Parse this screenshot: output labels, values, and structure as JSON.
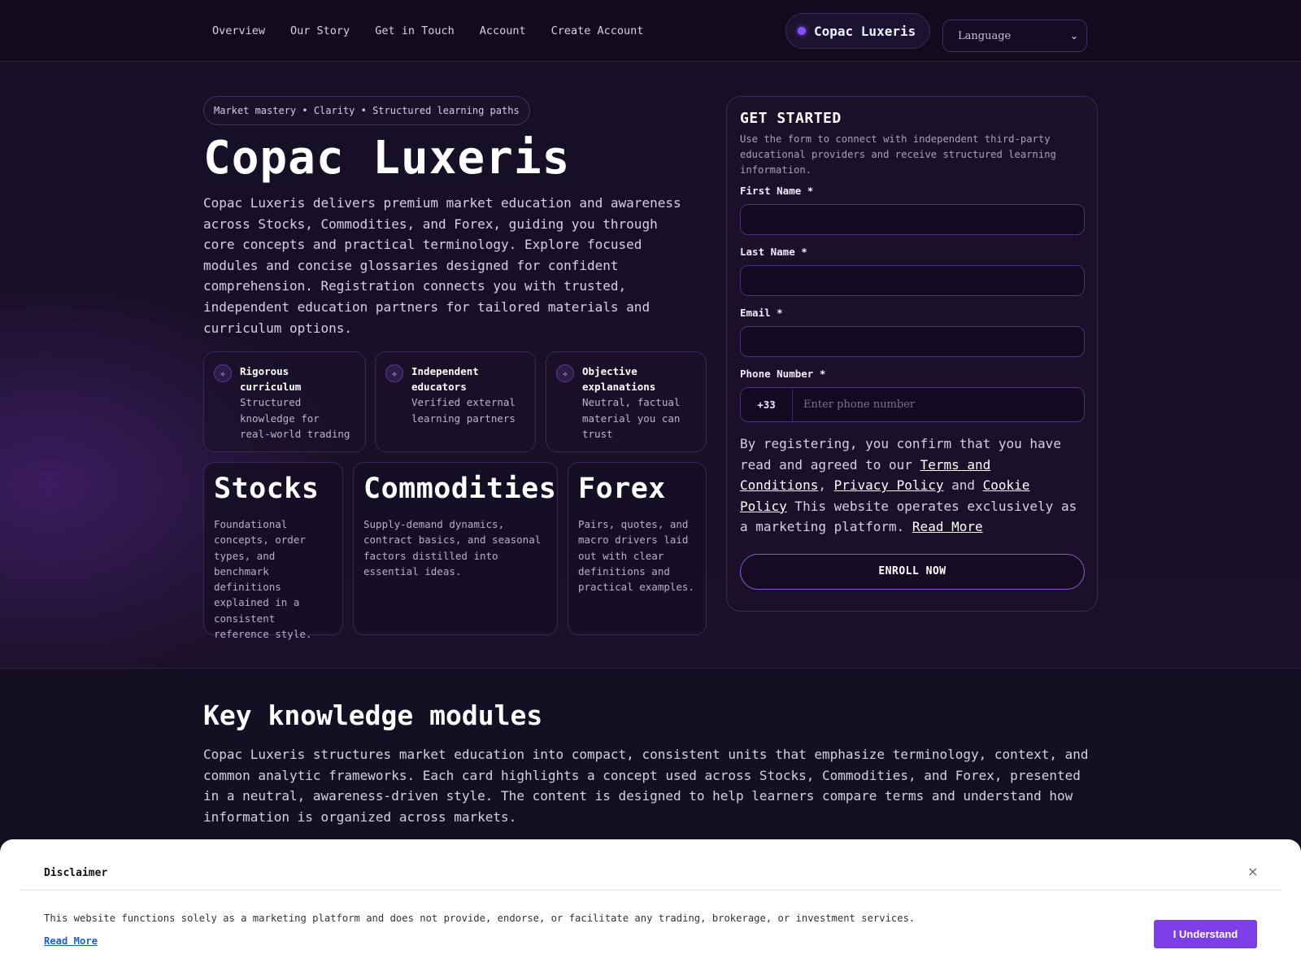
{
  "nav": {
    "items": [
      "Overview",
      "Our Story",
      "Get in Touch",
      "Account",
      "Create Account"
    ],
    "brand": "Copac Luxeris",
    "language_label": "Language"
  },
  "hero": {
    "tagline": "Market mastery • Clarity • Structured learning paths",
    "title": "Copac Luxeris",
    "description": "Copac Luxeris delivers premium market education and awareness across Stocks, Commodities, and Forex, guiding you through core concepts and practical terminology. Explore focused modules and concise glossaries designed for confident comprehension. Registration connects you with trusted, independent education partners for tailored materials and curriculum options.",
    "features": [
      {
        "title": "Rigorous curriculum",
        "desc": "Structured knowledge for real-world trading"
      },
      {
        "title": "Independent educators",
        "desc": "Verified external learning partners"
      },
      {
        "title": "Objective explanations",
        "desc": "Neutral, factual material you can trust"
      }
    ],
    "markets": [
      {
        "title": "Stocks",
        "desc": "Foundational concepts, order types, and benchmark definitions explained in a consistent reference style."
      },
      {
        "title": "Commodities",
        "desc": "Supply-demand dynamics, contract basics, and seasonal factors distilled into essential ideas."
      },
      {
        "title": "Forex",
        "desc": "Pairs, quotes, and macro drivers laid out with clear definitions and practical examples."
      }
    ]
  },
  "form": {
    "title": "GET STARTED",
    "subtitle": "Use the form to connect with independent third-party educational providers and receive structured learning information.",
    "first_name_label": "First Name *",
    "last_name_label": "Last Name *",
    "email_label": "Email *",
    "phone_label": "Phone Number *",
    "phone_code": "+33",
    "phone_placeholder": "Enter phone number",
    "consent_prefix": "By registering, you confirm that you have read and agreed to our ",
    "terms_link": "Terms and Conditions",
    "comma": ",",
    "privacy_link": "Privacy Policy",
    "and_text": " and ",
    "cookie_link": "Cookie Policy",
    "consent_suffix": " This website operates exclusively as a marketing platform. ",
    "read_more_link": "Read More",
    "submit_label": "ENROLL NOW"
  },
  "modules": {
    "title": "Key knowledge modules",
    "description": "Copac Luxeris structures market education into compact, consistent units that emphasize terminology, context, and common analytic frameworks. Each card highlights a concept used across Stocks, Commodities, and Forex, presented in a neutral, awareness-driven style. The content is designed to help learners compare terms and understand how information is organized across markets."
  },
  "disclaimer": {
    "title": "Disclaimer",
    "close_icon": "×",
    "text": "This website functions solely as a marketing platform and does not provide, endorse, or facilitate any trading, brokerage, or investment services.",
    "read_more": "Read More",
    "button_label": "I Understand"
  },
  "icons": {
    "feature_icon": "✧",
    "select_chevron": "⌄"
  },
  "colors": {
    "accent": "#8b4dff",
    "button_accent": "#7d3ee8",
    "background": "#150e22"
  }
}
